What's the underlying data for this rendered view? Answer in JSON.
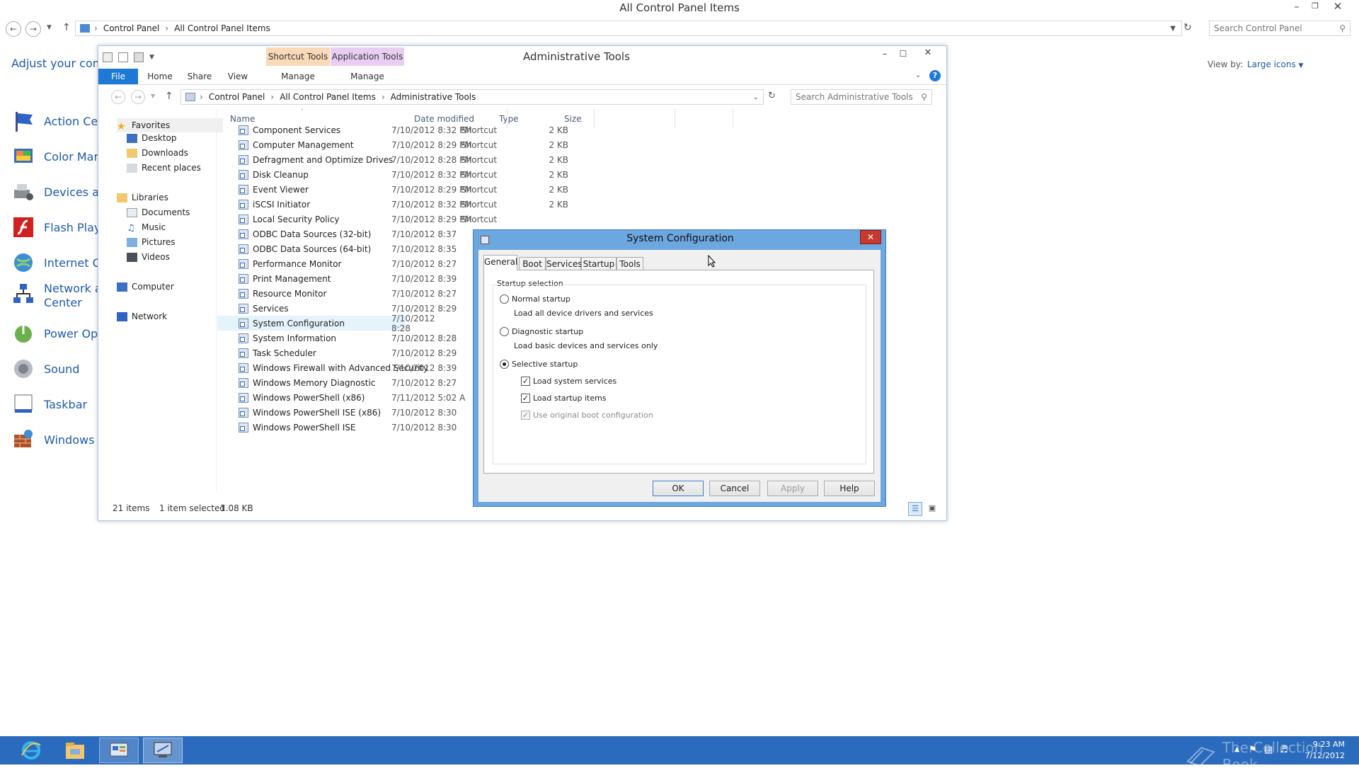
{
  "outer_window": {
    "title": "All Control Panel Items",
    "breadcrumb": [
      "Control Panel",
      "All Control Panel Items"
    ],
    "search_placeholder": "Search Control Panel",
    "heading": "Adjust your comp",
    "view_by_label": "View by:",
    "view_by_value": "Large icons",
    "items": [
      {
        "label": "Action Cen",
        "icon": "flag-icon"
      },
      {
        "label": "Color Mana",
        "icon": "color-management-icon"
      },
      {
        "label": "Devices an",
        "icon": "devices-icon"
      },
      {
        "label": "Flash Playe",
        "icon": "flash-icon"
      },
      {
        "label": "Internet Op",
        "icon": "globe-icon"
      },
      {
        "label": "Network ar",
        "label2": "Center",
        "icon": "network-icon"
      },
      {
        "label": "Power Opti",
        "icon": "power-icon"
      },
      {
        "label": "Sound",
        "icon": "sound-icon"
      },
      {
        "label": "Taskbar",
        "icon": "taskbar-icon"
      },
      {
        "label": "Windows F",
        "icon": "firewall-icon"
      }
    ]
  },
  "inner_window": {
    "title": "Administrative Tools",
    "context_tabs": {
      "shortcut": "Shortcut Tools",
      "application": "Application Tools"
    },
    "ribbon_tabs": {
      "file": "File",
      "home": "Home",
      "share": "Share",
      "view": "View",
      "manage1": "Manage",
      "manage2": "Manage"
    },
    "breadcrumb": [
      "Control Panel",
      "All Control Panel Items",
      "Administrative Tools"
    ],
    "search_placeholder": "Search Administrative Tools",
    "columns": {
      "name": "Name",
      "date": "Date modified",
      "type": "Type",
      "size": "Size"
    },
    "nav": {
      "favorites": "Favorites",
      "desktop": "Desktop",
      "downloads": "Downloads",
      "recent": "Recent places",
      "libraries": "Libraries",
      "documents": "Documents",
      "music": "Music",
      "pictures": "Pictures",
      "videos": "Videos",
      "computer": "Computer",
      "network": "Network"
    },
    "files": [
      {
        "name": "Component Services",
        "date": "7/10/2012 8:32 PM",
        "type": "Shortcut",
        "size": "2 KB"
      },
      {
        "name": "Computer Management",
        "date": "7/10/2012 8:29 PM",
        "type": "Shortcut",
        "size": "2 KB"
      },
      {
        "name": "Defragment and Optimize Drives",
        "date": "7/10/2012 8:28 PM",
        "type": "Shortcut",
        "size": "2 KB"
      },
      {
        "name": "Disk Cleanup",
        "date": "7/10/2012 8:32 PM",
        "type": "Shortcut",
        "size": "2 KB"
      },
      {
        "name": "Event Viewer",
        "date": "7/10/2012 8:29 PM",
        "type": "Shortcut",
        "size": "2 KB"
      },
      {
        "name": "iSCSI Initiator",
        "date": "7/10/2012 8:32 PM",
        "type": "Shortcut",
        "size": "2 KB"
      },
      {
        "name": "Local Security Policy",
        "date": "7/10/2012 8:29 PM",
        "type": "Shortcut",
        "size": ""
      },
      {
        "name": "ODBC Data Sources (32-bit)",
        "date": "7/10/2012 8:37",
        "type": "",
        "size": ""
      },
      {
        "name": "ODBC Data Sources (64-bit)",
        "date": "7/10/2012 8:35",
        "type": "",
        "size": ""
      },
      {
        "name": "Performance Monitor",
        "date": "7/10/2012 8:27",
        "type": "",
        "size": ""
      },
      {
        "name": "Print Management",
        "date": "7/10/2012 8:39",
        "type": "",
        "size": ""
      },
      {
        "name": "Resource Monitor",
        "date": "7/10/2012 8:27",
        "type": "",
        "size": ""
      },
      {
        "name": "Services",
        "date": "7/10/2012 8:29",
        "type": "",
        "size": ""
      },
      {
        "name": "System Configuration",
        "date": "7/10/2012 8:28",
        "type": "",
        "size": ""
      },
      {
        "name": "System Information",
        "date": "7/10/2012 8:28",
        "type": "",
        "size": ""
      },
      {
        "name": "Task Scheduler",
        "date": "7/10/2012 8:29",
        "type": "",
        "size": ""
      },
      {
        "name": "Windows Firewall with Advanced Security",
        "date": "7/10/2012 8:39",
        "type": "",
        "size": ""
      },
      {
        "name": "Windows Memory Diagnostic",
        "date": "7/10/2012 8:27",
        "type": "",
        "size": ""
      },
      {
        "name": "Windows PowerShell (x86)",
        "date": "7/11/2012 5:02 A",
        "type": "",
        "size": ""
      },
      {
        "name": "Windows PowerShell ISE (x86)",
        "date": "7/10/2012 8:30",
        "type": "",
        "size": ""
      },
      {
        "name": "Windows PowerShell ISE",
        "date": "7/10/2012 8:30",
        "type": "",
        "size": ""
      }
    ],
    "status": {
      "count": "21 items",
      "selected": "1 item selected",
      "size": "1.08 KB"
    }
  },
  "dialog": {
    "title": "System Configuration",
    "tabs": {
      "general": "General",
      "boot": "Boot",
      "services": "Services",
      "startup": "Startup",
      "tools": "Tools"
    },
    "group_label": "Startup selection",
    "normal": {
      "label": "Normal startup",
      "desc": "Load all device drivers and services"
    },
    "diagnostic": {
      "label": "Diagnostic startup",
      "desc": "Load basic devices and services only"
    },
    "selective": {
      "label": "Selective startup"
    },
    "load_system_services": "Load system services",
    "load_startup_items": "Load startup items",
    "use_original_boot": "Use original boot configuration",
    "buttons": {
      "ok": "OK",
      "cancel": "Cancel",
      "apply": "Apply",
      "help": "Help"
    }
  },
  "taskbar": {
    "time": "9:23 AM",
    "date": "7/12/2012",
    "watermark": "The Collection Book"
  }
}
